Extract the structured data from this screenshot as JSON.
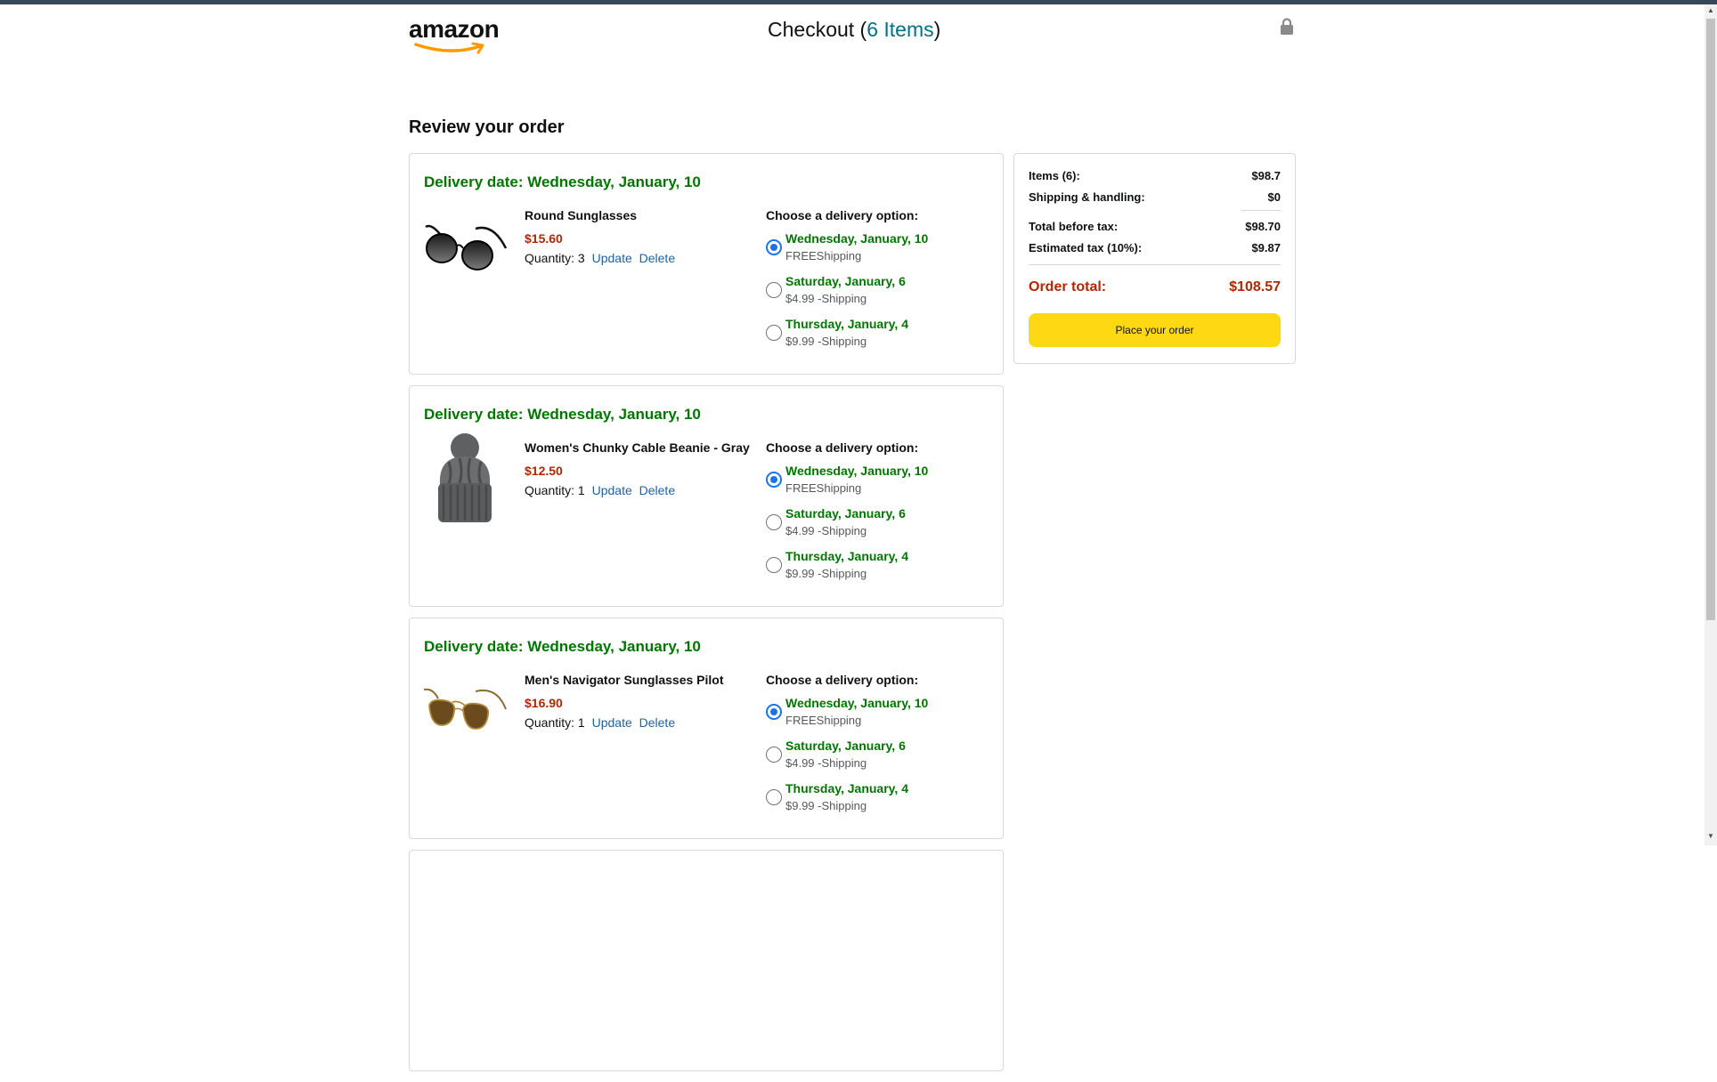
{
  "header": {
    "logo": "amazon",
    "title_prefix": "Checkout (",
    "item_count_link": "6 Items",
    "title_suffix": ")"
  },
  "review_title": "Review your order",
  "options_title": "Choose a delivery option:",
  "links": {
    "update": "Update",
    "delete": "Delete"
  },
  "items": [
    {
      "delivery_date": "Delivery date: Wednesday, January, 10",
      "name": "Round Sunglasses",
      "price": "$15.60",
      "quantity": "Quantity: 3",
      "image": "round-sunglasses-image",
      "options": [
        {
          "date": "Wednesday, January, 10",
          "price": "FREEShipping",
          "checked": true
        },
        {
          "date": "Saturday, January, 6",
          "price": "$4.99 -Shipping",
          "checked": false
        },
        {
          "date": "Thursday, January, 4",
          "price": "$9.99 -Shipping",
          "checked": false
        }
      ]
    },
    {
      "delivery_date": "Delivery date: Wednesday, January, 10",
      "name": "Women's Chunky Cable Beanie - Gray",
      "price": "$12.50",
      "quantity": "Quantity: 1",
      "image": "beanie-image",
      "options": [
        {
          "date": "Wednesday, January, 10",
          "price": "FREEShipping",
          "checked": true
        },
        {
          "date": "Saturday, January, 6",
          "price": "$4.99 -Shipping",
          "checked": false
        },
        {
          "date": "Thursday, January, 4",
          "price": "$9.99 -Shipping",
          "checked": false
        }
      ]
    },
    {
      "delivery_date": "Delivery date: Wednesday, January, 10",
      "name": "Men's Navigator Sunglasses Pilot",
      "price": "$16.90",
      "quantity": "Quantity: 1",
      "image": "navigator-sunglasses-image",
      "options": [
        {
          "date": "Wednesday, January, 10",
          "price": "FREEShipping",
          "checked": true
        },
        {
          "date": "Saturday, January, 6",
          "price": "$4.99 -Shipping",
          "checked": false
        },
        {
          "date": "Thursday, January, 4",
          "price": "$9.99 -Shipping",
          "checked": false
        }
      ]
    }
  ],
  "summary": {
    "items_label": "Items (6):",
    "items_value": "$98.7",
    "shipping_label": "Shipping & handling:",
    "shipping_value": "$0",
    "before_tax_label": "Total before tax:",
    "before_tax_value": "$98.70",
    "tax_label": "Estimated tax (10%):",
    "tax_value": "$9.87",
    "total_label": "Order total:",
    "total_value": "$108.57",
    "place_order": "Place your order"
  },
  "colors": {
    "green": "#007600",
    "price_red": "#b12704",
    "link_blue": "#2162a1",
    "button_yellow": "#ffd814",
    "radio_blue": "#1a73e8",
    "topbar": "#37475a"
  },
  "icons": {
    "lock": "lock-icon",
    "logo_smile": "amazon-smile-arrow"
  }
}
